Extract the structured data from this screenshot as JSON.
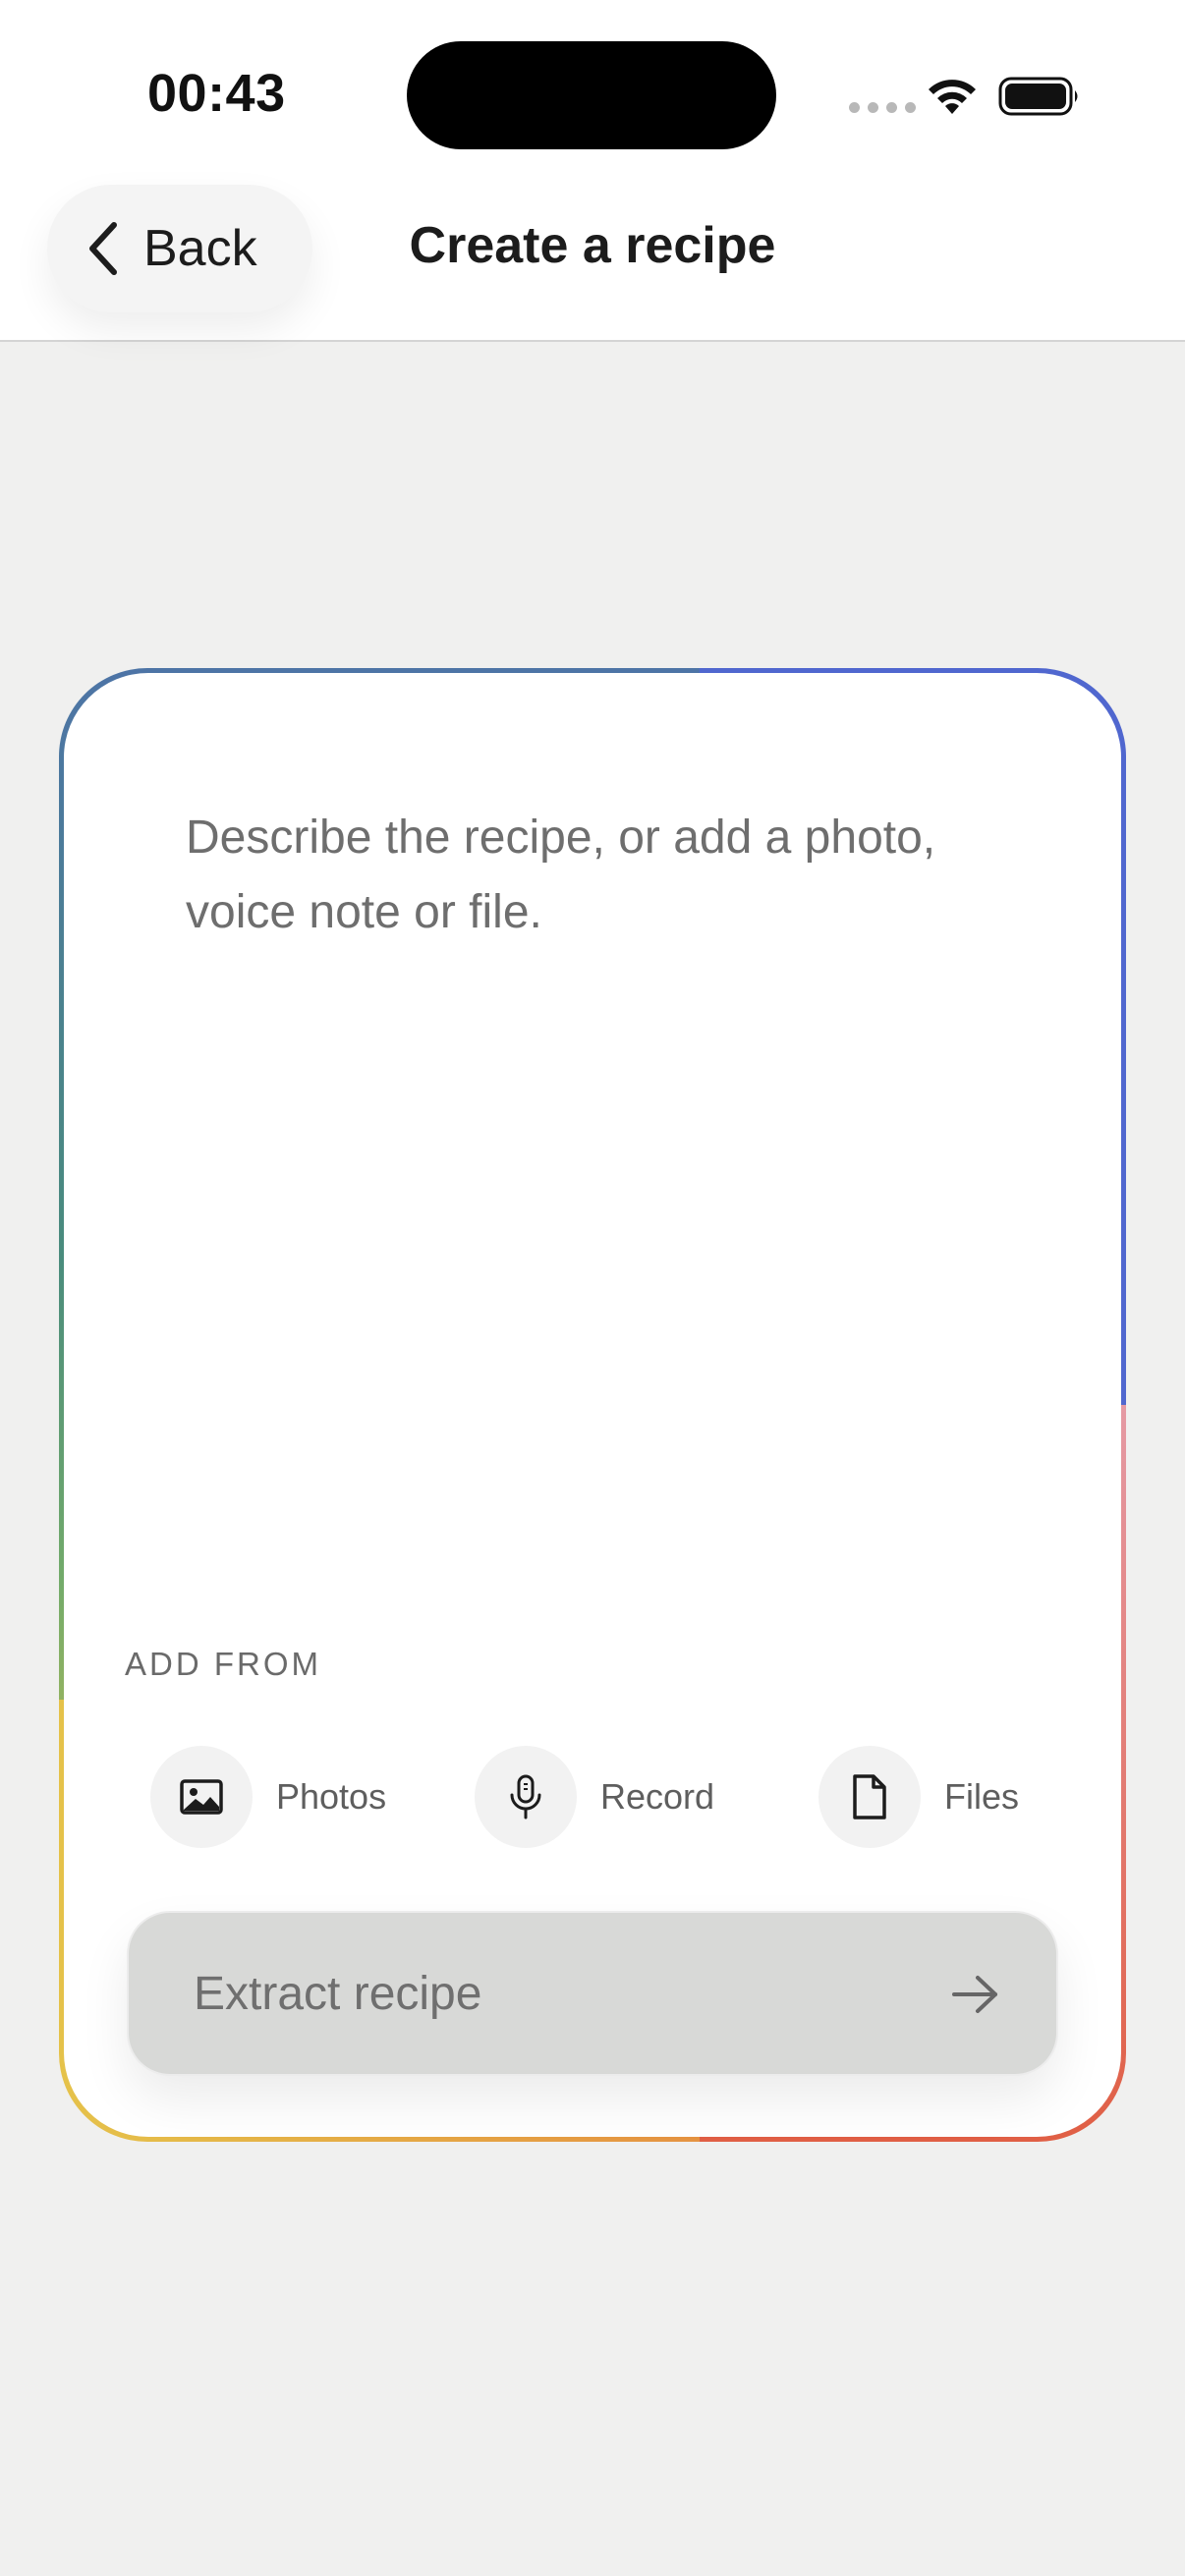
{
  "status_bar": {
    "time": "00:43",
    "icons": [
      "signal-dots-icon",
      "wifi-icon",
      "battery-icon"
    ]
  },
  "nav": {
    "back_label": "Back",
    "title": "Create a recipe"
  },
  "card": {
    "placeholder": "Describe the recipe, or add a photo, voice note or file.",
    "add_from_label": "ADD FROM",
    "sources": [
      {
        "label": "Photos",
        "icon": "photo-icon"
      },
      {
        "label": "Record",
        "icon": "microphone-icon"
      },
      {
        "label": "Files",
        "icon": "file-icon"
      }
    ],
    "extract_button_label": "Extract recipe",
    "extract_button_icon": "arrow-right-icon"
  },
  "colors": {
    "background": "#f0f0ef",
    "gradient_blue": "#5067cf",
    "gradient_green": "#4a8c7d",
    "gradient_yellow": "#e5c24a",
    "gradient_red": "#e0603f",
    "button_disabled": "#d8d9d7"
  }
}
